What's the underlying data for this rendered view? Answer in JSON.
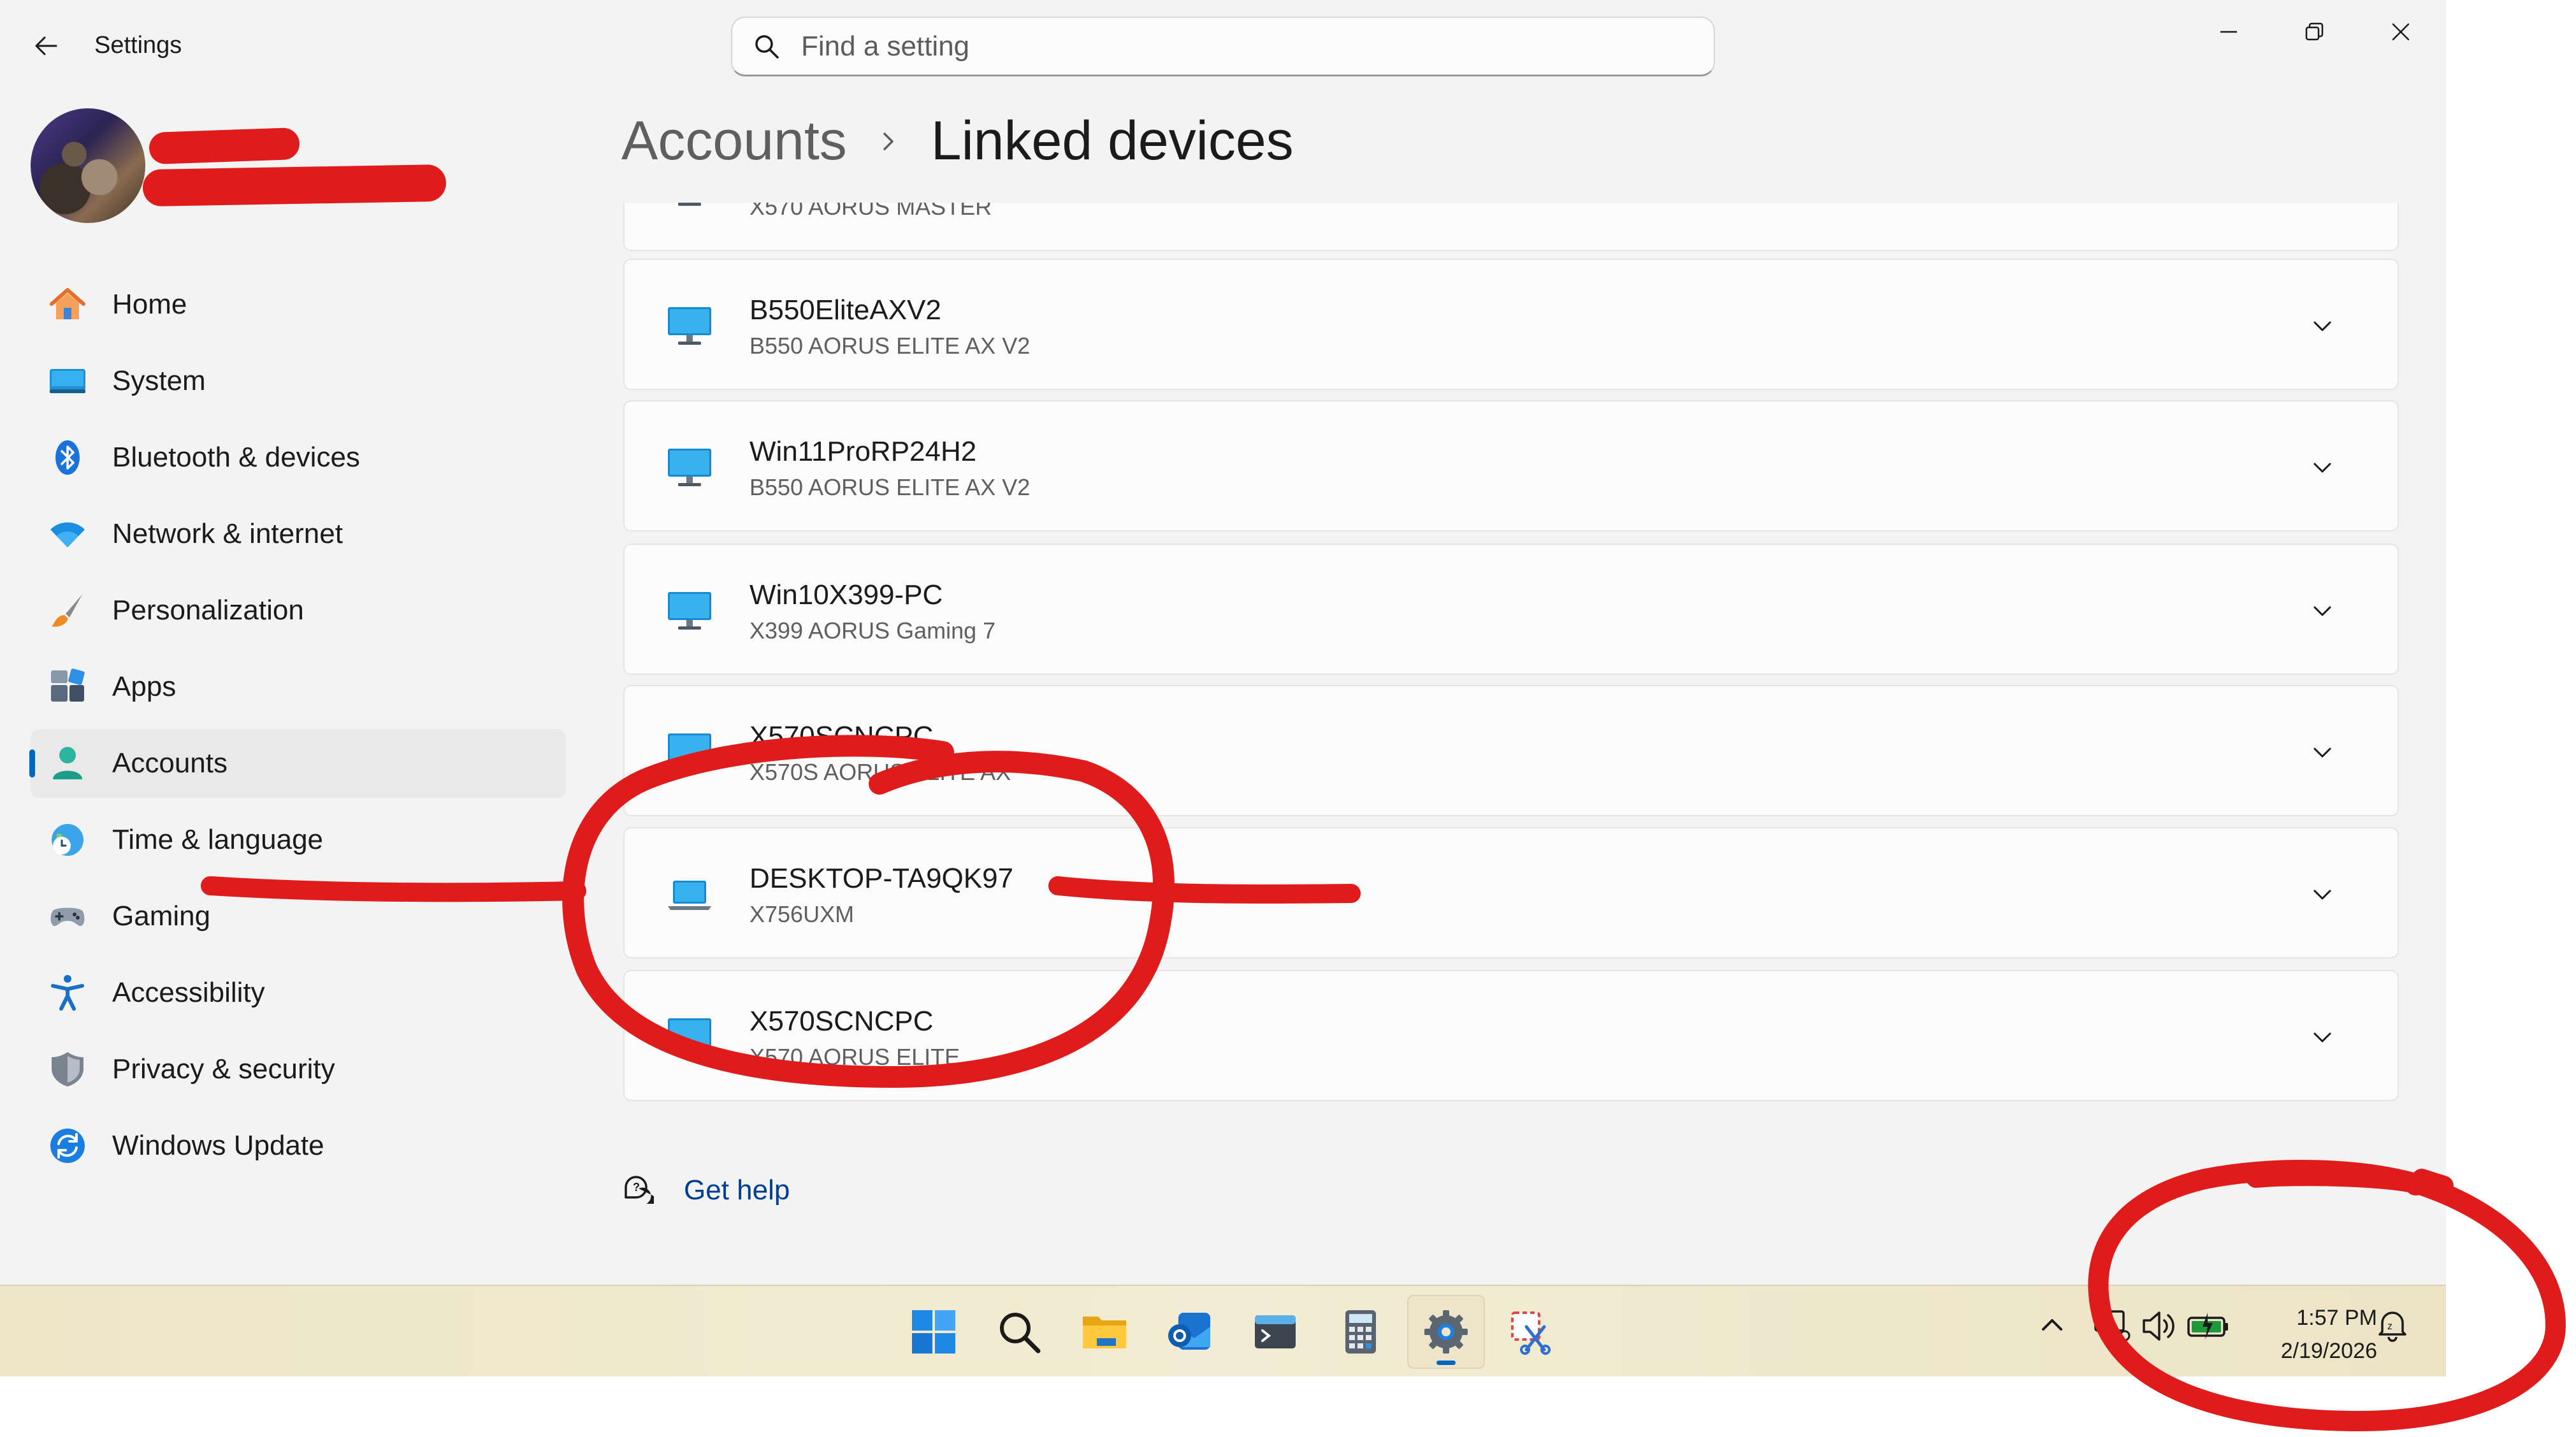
{
  "window": {
    "app_title": "Settings",
    "back_icon": "arrow-left-icon",
    "controls": [
      "minimize-icon",
      "restore-icon",
      "close-icon"
    ]
  },
  "search": {
    "placeholder": "Find a setting",
    "value": ""
  },
  "user": {
    "name": "",
    "email": ""
  },
  "sidebar": {
    "items": [
      {
        "label": "Home",
        "icon": "home-icon",
        "selected": false
      },
      {
        "label": "System",
        "icon": "system-icon",
        "selected": false
      },
      {
        "label": "Bluetooth & devices",
        "icon": "bluetooth-icon",
        "selected": false
      },
      {
        "label": "Network & internet",
        "icon": "wifi-icon",
        "selected": false
      },
      {
        "label": "Personalization",
        "icon": "brush-icon",
        "selected": false
      },
      {
        "label": "Apps",
        "icon": "apps-icon",
        "selected": false
      },
      {
        "label": "Accounts",
        "icon": "person-icon",
        "selected": true
      },
      {
        "label": "Time & language",
        "icon": "globe-clock-icon",
        "selected": false
      },
      {
        "label": "Gaming",
        "icon": "gamepad-icon",
        "selected": false
      },
      {
        "label": "Accessibility",
        "icon": "accessibility-icon",
        "selected": false
      },
      {
        "label": "Privacy & security",
        "icon": "shield-icon",
        "selected": false
      },
      {
        "label": "Windows Update",
        "icon": "update-icon",
        "selected": false
      }
    ]
  },
  "breadcrumb": {
    "parent": "Accounts",
    "current": "Linked devices"
  },
  "devices": [
    {
      "name": "",
      "model": "X570 AORUS MASTER",
      "icon": "desktop-icon"
    },
    {
      "name": "B550EliteAXV2",
      "model": "B550 AORUS ELITE AX V2",
      "icon": "desktop-icon"
    },
    {
      "name": "Win11ProRP24H2",
      "model": "B550 AORUS ELITE AX V2",
      "icon": "desktop-icon"
    },
    {
      "name": "Win10X399-PC",
      "model": "X399 AORUS Gaming 7",
      "icon": "desktop-icon"
    },
    {
      "name": "X570SCNCPC",
      "model": "X570S AORUS ELITE AX",
      "icon": "desktop-icon"
    },
    {
      "name": "DESKTOP-TA9QK97",
      "model": "X756UXM",
      "icon": "laptop-icon"
    },
    {
      "name": "X570SCNCPC",
      "model": "X570 AORUS ELITE",
      "icon": "desktop-icon"
    }
  ],
  "help": {
    "label": "Get help",
    "icon": "help-chat-icon"
  },
  "taskbar": {
    "apps": [
      {
        "name": "start",
        "icon": "windows-logo-icon",
        "active": false
      },
      {
        "name": "search",
        "icon": "search-icon",
        "active": false
      },
      {
        "name": "file-explorer",
        "icon": "folder-icon",
        "active": false
      },
      {
        "name": "outlook",
        "icon": "outlook-icon",
        "active": false
      },
      {
        "name": "terminal",
        "icon": "terminal-icon",
        "active": false
      },
      {
        "name": "calculator",
        "icon": "calculator-icon",
        "active": false
      },
      {
        "name": "settings",
        "icon": "gear-icon",
        "active": true
      },
      {
        "name": "snipping-tool",
        "icon": "snipping-tool-icon",
        "active": false
      }
    ],
    "tray": [
      "chevron-up-icon",
      "network-icon",
      "volume-icon",
      "battery-icon"
    ],
    "time": "1:57 PM",
    "date": "2/19/2026",
    "notification_icon": "notification-bell-icon"
  },
  "colors": {
    "accent": "#0067c0",
    "annotation": "#e01b1b",
    "background": "#f3f3f3",
    "card": "#fbfbfb",
    "link": "#003e92"
  }
}
